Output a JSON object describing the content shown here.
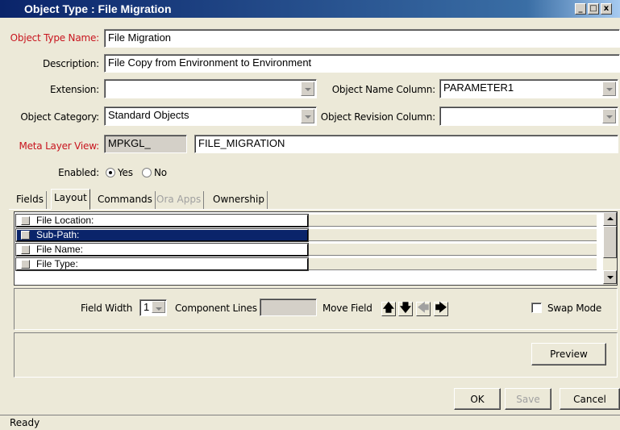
{
  "window": {
    "title": "Object Type : File Migration",
    "controls": {
      "minimize": "_",
      "maximize": "□",
      "close": "x"
    }
  },
  "form": {
    "object_type_name_label": "Object Type Name:",
    "object_type_name_value": "File Migration",
    "description_label": "Description:",
    "description_value": "File Copy from Environment to Environment",
    "extension_label": "Extension:",
    "extension_value": "",
    "object_name_column_label": "Object Name Column:",
    "object_name_column_value": "PARAMETER1",
    "object_category_label": "Object Category:",
    "object_category_value": "Standard Objects",
    "object_revision_column_label": "Object Revision Column:",
    "object_revision_column_value": "",
    "meta_layer_view_label": "Meta Layer View:",
    "meta_layer_prefix": "MPKGL_",
    "meta_layer_value": "FILE_MIGRATION",
    "enabled_label": "Enabled:",
    "enabled_yes": "Yes",
    "enabled_no": "No",
    "enabled_selected": "Yes"
  },
  "tabs": [
    {
      "label": "Fields",
      "active": false,
      "disabled": false
    },
    {
      "label": "Layout",
      "active": true,
      "disabled": false
    },
    {
      "label": "Commands",
      "active": false,
      "disabled": false
    },
    {
      "label": "Ora Apps",
      "active": false,
      "disabled": true
    },
    {
      "label": "Ownership",
      "active": false,
      "disabled": false
    }
  ],
  "layout_grid": {
    "rows": [
      {
        "label": "File Location:",
        "selected": false
      },
      {
        "label": "Sub-Path:",
        "selected": true
      },
      {
        "label": "File Name:",
        "selected": false
      },
      {
        "label": "File Type:",
        "selected": false
      }
    ]
  },
  "layout_controls": {
    "field_width_label": "Field Width",
    "field_width_value": "1",
    "component_lines_label": "Component Lines",
    "component_lines_value": "",
    "move_field_label": "Move Field",
    "swap_mode_label": "Swap Mode",
    "swap_mode_checked": false,
    "preview_label": "Preview"
  },
  "footer": {
    "ok_label": "OK",
    "save_label": "Save",
    "cancel_label": "Cancel"
  },
  "status": {
    "text": "Ready"
  },
  "colors": {
    "title_bar": "#0a246a",
    "required_label": "#c8141e",
    "selection": "#0a246a",
    "window_bg": "#ece9d8"
  }
}
